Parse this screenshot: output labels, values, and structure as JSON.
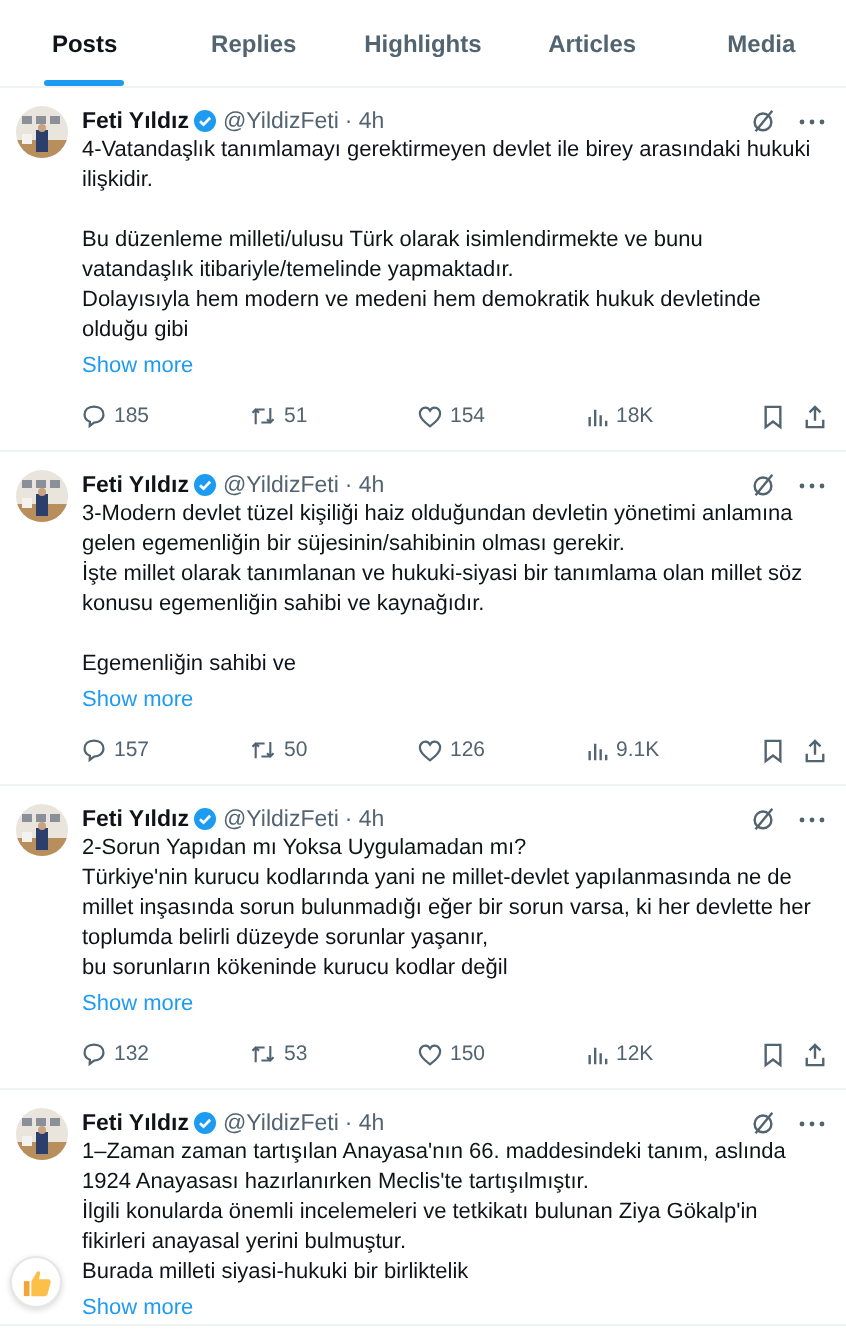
{
  "tabs": [
    {
      "label": "Posts",
      "selected": true
    },
    {
      "label": "Replies",
      "selected": false
    },
    {
      "label": "Highlights",
      "selected": false
    },
    {
      "label": "Articles",
      "selected": false
    },
    {
      "label": "Media",
      "selected": false
    }
  ],
  "posts": [
    {
      "avatar": {
        "kind": "picture"
      },
      "name": "Feti Yıldız",
      "verified": true,
      "handle": "@YildizFeti",
      "time": "· 4h",
      "paragraphs": [
        [
          "4-Vatandaşlık tanımlamayı gerektirmeyen devlet ile birey arasındaki hukuki",
          "ilişkidir."
        ],
        [
          "Bu düzenleme milleti/ulusu Türk olarak isimlendirmekte ve bunu",
          "vatandaşlık itibariyle/temelinde yapmaktadır.",
          "Dolayısıyla hem modern ve medeni hem demokratik hukuk devletinde",
          "olduğu gibi"
        ]
      ],
      "show_more": "Show more",
      "stats": {
        "replies": "185",
        "reposts": "51",
        "likes": "154",
        "views": "18K"
      }
    },
    {
      "avatar": {
        "kind": "picture"
      },
      "name": "Feti Yıldız",
      "verified": true,
      "handle": "@YildizFeti",
      "time": "· 4h",
      "paragraphs": [
        [
          "3-Modern devlet tüzel kişiliği haiz olduğundan devletin yönetimi anlamına",
          "gelen egemenliğin bir süjesinin/sahibinin olması gerekir.",
          "İşte millet olarak tanımlanan ve hukuki-siyasi bir tanımlama olan millet söz",
          "konusu egemenliğin sahibi ve kaynağıdır."
        ],
        [
          "Egemenliğin sahibi ve"
        ]
      ],
      "show_more": "Show more",
      "stats": {
        "replies": "157",
        "reposts": "50",
        "likes": "126",
        "views": "9.1K"
      }
    },
    {
      "avatar": {
        "kind": "picture"
      },
      "name": "Feti Yıldız",
      "verified": true,
      "handle": "@YildizFeti",
      "time": "· 4h",
      "paragraphs": [
        [
          "2-Sorun Yapıdan mı Yoksa Uygulamadan mı?",
          "Türkiye'nin kurucu kodlarında yani ne millet-devlet yapılanmasında ne de",
          "millet inşasında sorun bulunmadığı eğer bir sorun varsa, ki her devlette her",
          "toplumda belirli düzeyde sorunlar yaşanır,",
          "bu sorunların kökeninde kurucu kodlar değil"
        ]
      ],
      "show_more": "Show more",
      "stats": {
        "replies": "132",
        "reposts": "53",
        "likes": "150",
        "views": "12K"
      }
    },
    {
      "avatar": {
        "kind": "picture"
      },
      "name": "Feti Yıldız",
      "verified": true,
      "handle": "@YildizFeti",
      "time": "· 4h",
      "paragraphs": [
        [
          "1–Zaman zaman tartışılan Anayasa'nın 66. maddesindeki tanım, aslında",
          "1924 Anayasası hazırlanırken Meclis'te tartışılmıştır.",
          "İlgili konularda önemli incelemeleri ve tetkikatı bulunan Ziya Gökalp'in",
          "fikirleri anayasal yerini bulmuştur.",
          "Burada milleti  siyasi-hukuki bir birliktelik"
        ]
      ],
      "show_more": "Show more"
    }
  ]
}
